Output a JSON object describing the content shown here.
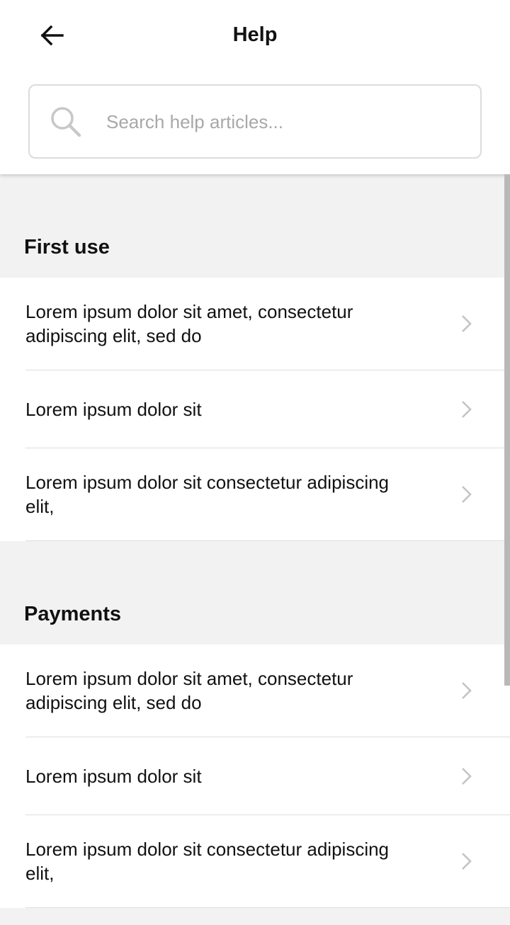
{
  "header": {
    "title": "Help",
    "back_icon": "arrow-left-icon"
  },
  "search": {
    "placeholder": "Search help articles...",
    "value": "",
    "icon": "search-icon"
  },
  "colors": {
    "background": "#f2f2f2",
    "surface": "#ffffff",
    "text": "#111111",
    "placeholder": "#a8a8a8",
    "divider": "#dddddd",
    "chevron": "#c4c4c4"
  },
  "sections": [
    {
      "title": "First use",
      "items": [
        {
          "label": "Lorem ipsum dolor sit amet, consectetur adipiscing elit, sed do"
        },
        {
          "label": "Lorem ipsum dolor sit"
        },
        {
          "label": "Lorem ipsum dolor sit consectetur adipiscing elit,"
        }
      ]
    },
    {
      "title": "Payments",
      "items": [
        {
          "label": "Lorem ipsum dolor sit amet, consectetur adipiscing elit, sed do"
        },
        {
          "label": "Lorem ipsum dolor sit"
        },
        {
          "label": "Lorem ipsum dolor sit consectetur adipiscing elit,"
        }
      ]
    }
  ]
}
